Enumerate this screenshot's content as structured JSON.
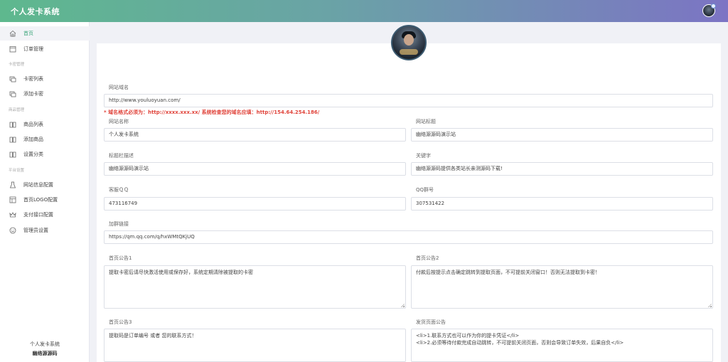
{
  "app": {
    "title": "个人发卡系统"
  },
  "sidebar": {
    "items": [
      {
        "label": "首页",
        "icon": "home-icon",
        "active": true
      },
      {
        "label": "订单管理",
        "icon": "order-icon"
      },
      {
        "section": "卡密管理"
      },
      {
        "label": "卡密列表",
        "icon": "cards-icon"
      },
      {
        "label": "添加卡密",
        "icon": "cards-add-icon"
      },
      {
        "section": "商品管理"
      },
      {
        "label": "商品列表",
        "icon": "book-icon"
      },
      {
        "label": "添加商品",
        "icon": "book-add-icon"
      },
      {
        "label": "设置分类",
        "icon": "category-icon"
      },
      {
        "section": "平台设置"
      },
      {
        "label": "网站信息配置",
        "icon": "flask-icon"
      },
      {
        "label": "首页LOGO配置",
        "icon": "layout-icon"
      },
      {
        "label": "支付接口配置",
        "icon": "crown-icon"
      },
      {
        "label": "管理员设置",
        "icon": "smile-icon"
      }
    ],
    "footer_line1": "个人发卡系统",
    "footer_line2": "幽络源源码"
  },
  "form": {
    "domain_label": "网站域名",
    "domain_value": "http://www.youluoyuan.com/",
    "domain_notice": "* 域名格式必须为：http://xxxx.xxx.xx/ 系统检查您的域名应填：http://154.64.254.186/",
    "site_name_label": "网站名称",
    "site_name_value": "个人发卡系统",
    "site_title_label": "网站标题",
    "site_title_value": "幽络源源码演示站",
    "desc_label": "标题栏描述",
    "desc_value": "幽络源源码演示站",
    "keywords_label": "关键字",
    "keywords_value": "幽络源源码提供各类站长亲测源码下载!",
    "qq_label": "客服ＱＱ",
    "qq_value": "473116749",
    "qq_group_label": "QQ群号",
    "qq_group_value": "307531422",
    "join_link_label": "加群链接",
    "join_link_value": "https://qm.qq.com/q/hxWMtQKjUQ",
    "notice1_label": "首页公告1",
    "notice1_value": "提取卡密后请尽快激活使用或保存好，系统定期清除被提取的卡密",
    "notice2_label": "首页公告2",
    "notice2_value": "付款后按提示点击确定跳转到提取页面，不可提前关闭窗口！否则无法提取到卡密！",
    "notice3_label": "首页公告3",
    "notice3_value": "提取码是订单编号 或者 您的联系方式！",
    "ship_label": "发货页面公告",
    "ship_line1": "<li>1.联系方式也可以作为你的提卡凭证</li>",
    "ship_line2": "<li>2.必须等待付款完成自动跳转，不可提前关闭页面，否则会导致订单失效，后果自负</li>"
  },
  "colors": {
    "accent": "#3aa57a",
    "notice": "#e0433a"
  }
}
